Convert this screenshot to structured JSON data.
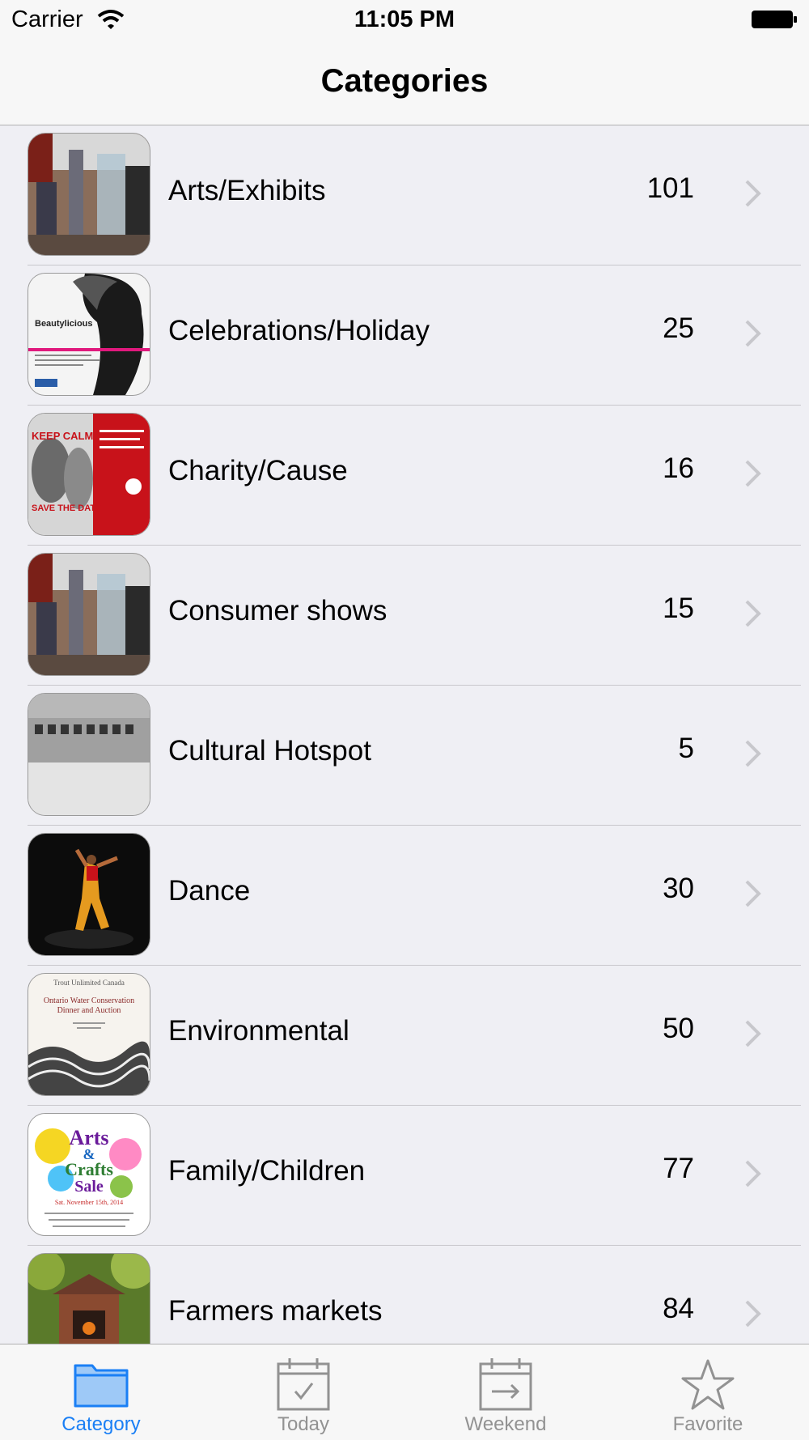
{
  "status_bar": {
    "carrier": "Carrier",
    "time": "11:05 PM"
  },
  "nav": {
    "title": "Categories"
  },
  "categories": [
    {
      "label": "Arts/Exhibits",
      "count": "101"
    },
    {
      "label": "Celebrations/Holiday",
      "count": "25"
    },
    {
      "label": "Charity/Cause",
      "count": "16"
    },
    {
      "label": "Consumer shows",
      "count": "15"
    },
    {
      "label": "Cultural Hotspot",
      "count": "5"
    },
    {
      "label": "Dance",
      "count": "30"
    },
    {
      "label": "Environmental",
      "count": "50"
    },
    {
      "label": "Family/Children",
      "count": "77"
    },
    {
      "label": "Farmers markets",
      "count": "84"
    }
  ],
  "thumbnail_text": {
    "beauty_brand": "Beautylicious",
    "keep_calm": "KEEP CALM",
    "save_date": "SAVE THE DATE",
    "trout_header": "Trout Unlimited Canada",
    "ontario_title": "Ontario Water Conservation",
    "dinner": "Dinner and Auction",
    "arts": "Arts",
    "and": "&",
    "crafts": "Crafts",
    "sale": "Sale",
    "sale_date": "Sat. November 15th, 2014"
  },
  "tabs": [
    {
      "label": "Category",
      "icon": "folder-icon",
      "active": true
    },
    {
      "label": "Today",
      "icon": "calendar-check-icon",
      "active": false
    },
    {
      "label": "Weekend",
      "icon": "calendar-arrow-icon",
      "active": false
    },
    {
      "label": "Favorite",
      "icon": "star-icon",
      "active": false
    }
  ],
  "colors": {
    "accent": "#1a7ff5",
    "inactive_tab": "#929292",
    "background": "#efeff4"
  }
}
